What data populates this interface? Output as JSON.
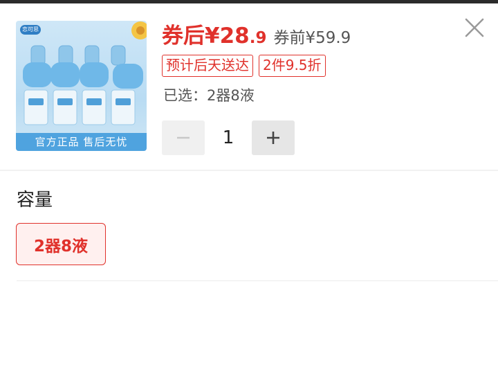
{
  "product": {
    "image_banner": "官方正品 售后无忧",
    "image_logo": "恋可思"
  },
  "price": {
    "coupon_prefix": "券后",
    "coupon_integer": "¥28",
    "coupon_decimal": ".9",
    "original": "券前¥59.9",
    "color": "#e0312b"
  },
  "tags": [
    {
      "label": "预计后天送达"
    },
    {
      "label": "2件9.5折"
    }
  ],
  "selected": {
    "text": "已选：2器8液"
  },
  "quantity": {
    "minus_icon": "minus-icon",
    "value": "1",
    "plus_icon": "plus-icon"
  },
  "options": {
    "section_title": "容量",
    "items": [
      {
        "label": "2器8液",
        "selected": true
      }
    ]
  },
  "icons": {
    "close": "close-icon"
  }
}
